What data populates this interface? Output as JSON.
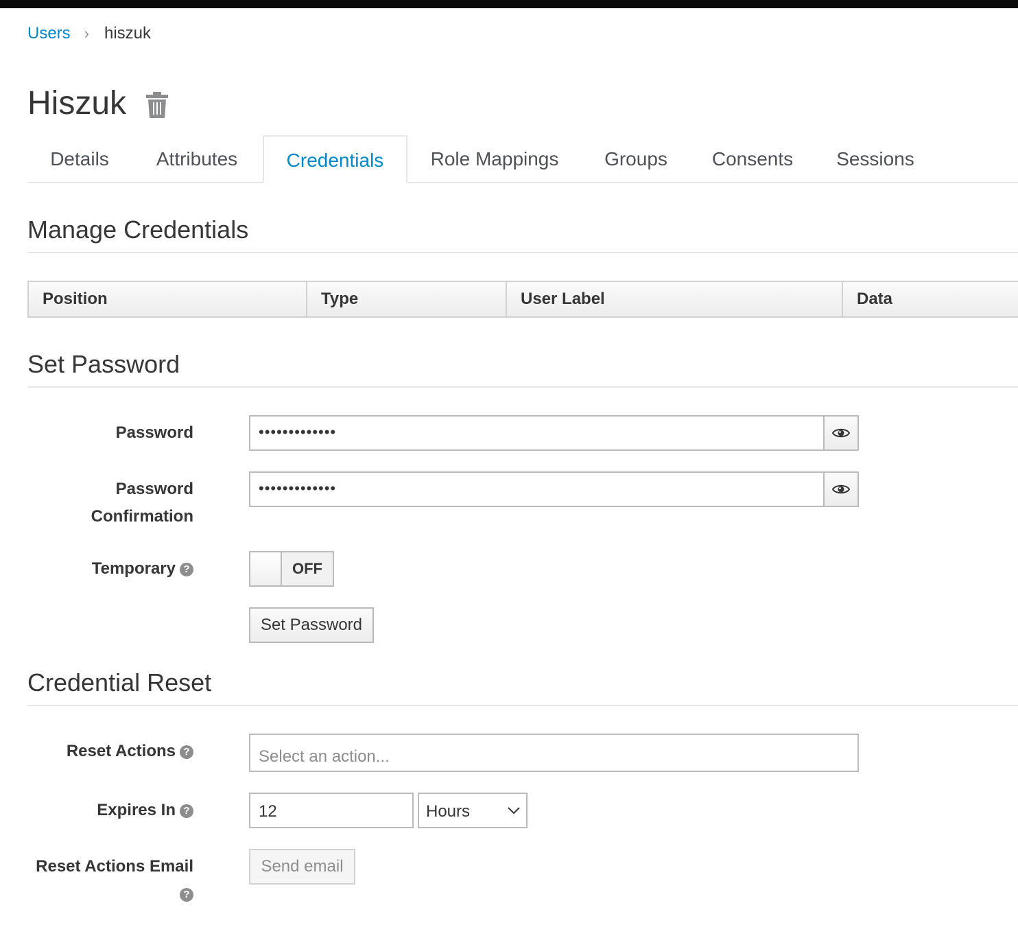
{
  "breadcrumb": {
    "parent": "Users",
    "separator": "›",
    "current": "hiszuk"
  },
  "page": {
    "title": "Hiszuk"
  },
  "tabs": [
    {
      "label": "Details"
    },
    {
      "label": "Attributes"
    },
    {
      "label": "Credentials",
      "active": true
    },
    {
      "label": "Role Mappings"
    },
    {
      "label": "Groups"
    },
    {
      "label": "Consents"
    },
    {
      "label": "Sessions"
    }
  ],
  "manage": {
    "title": "Manage Credentials",
    "columns": [
      "Position",
      "Type",
      "User Label",
      "Data"
    ]
  },
  "set_password": {
    "title": "Set Password",
    "password_label": "Password",
    "password_value": "•••••••••••••",
    "confirm_label_line1": "Password",
    "confirm_label_line2": "Confirmation",
    "confirm_value": "•••••••••••••",
    "temporary_label": "Temporary",
    "toggle_state": "OFF",
    "submit": "Set Password"
  },
  "reset": {
    "title": "Credential Reset",
    "actions_label": "Reset Actions",
    "actions_placeholder": "Select an action...",
    "expires_label": "Expires In",
    "expires_value": "12",
    "expires_unit": "Hours",
    "email_label": "Reset Actions Email",
    "email_button": "Send email"
  },
  "icons": {
    "help": "?",
    "trash": "trash-icon",
    "eye": "eye-icon",
    "chevron": "chevron-down-icon"
  },
  "colors": {
    "accent": "#0088ce",
    "text": "#363636",
    "muted": "#8b8d8f",
    "border": "#bbbbbb"
  }
}
